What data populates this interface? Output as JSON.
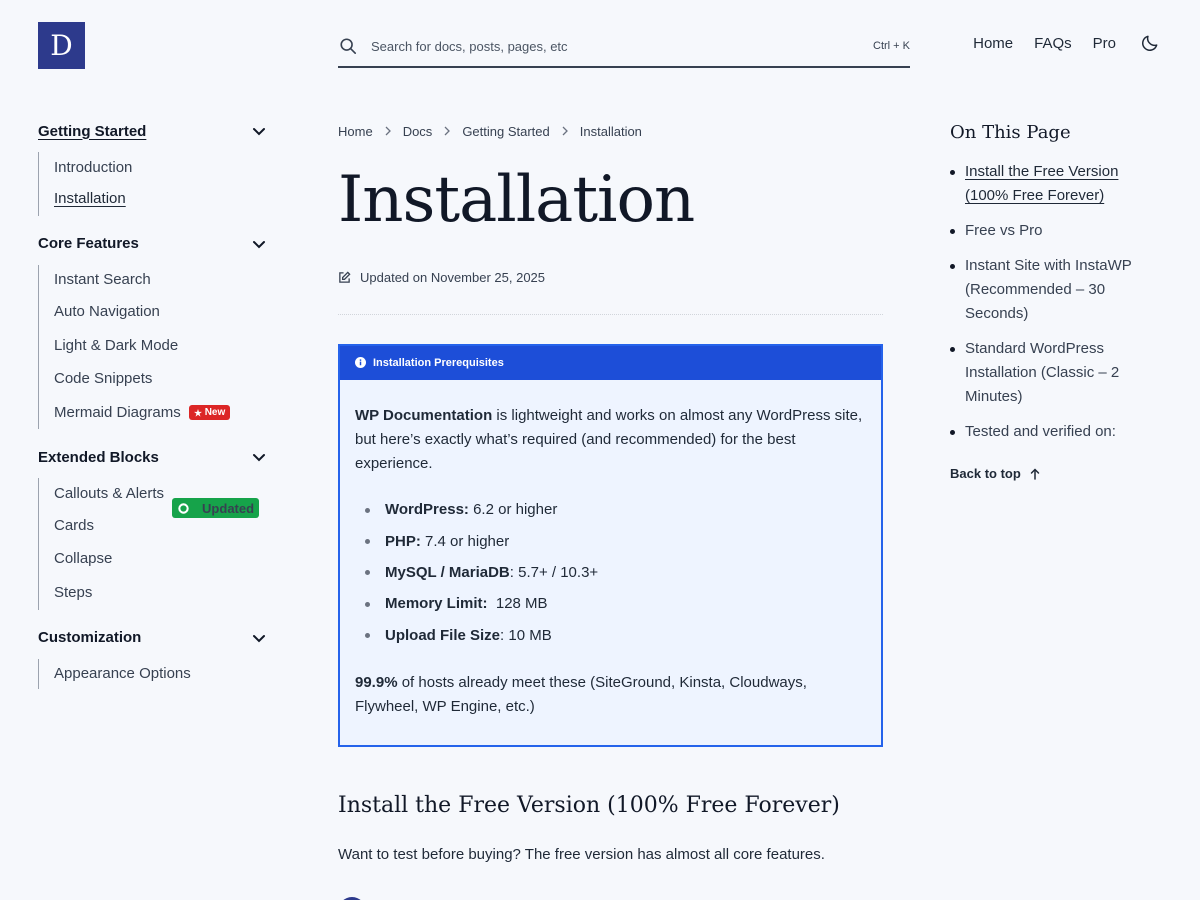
{
  "header": {
    "logo_letter": "D",
    "search_placeholder": "Search for docs, posts, pages, etc",
    "search_shortcut": "Ctrl + K",
    "nav": [
      {
        "label": "Home"
      },
      {
        "label": "FAQs"
      },
      {
        "label": "Pro"
      }
    ]
  },
  "sidebar": {
    "sections": [
      {
        "title": "Getting Started",
        "items": [
          {
            "label": "Introduction"
          },
          {
            "label": "Installation"
          }
        ]
      },
      {
        "title": "Core Features",
        "items": [
          {
            "label": "Instant Search"
          },
          {
            "label": "Auto Navigation"
          },
          {
            "label": "Light & Dark Mode"
          },
          {
            "label": "Code Snippets"
          },
          {
            "label": "Mermaid Diagrams",
            "badge": "New"
          }
        ]
      },
      {
        "title": "Extended Blocks",
        "items": [
          {
            "label": "Callouts & Alerts",
            "badge": "Updated"
          },
          {
            "label": "Cards"
          },
          {
            "label": "Collapse"
          },
          {
            "label": "Steps"
          }
        ]
      },
      {
        "title": "Customization",
        "items": [
          {
            "label": "Appearance Options"
          }
        ]
      }
    ]
  },
  "main": {
    "breadcrumb": [
      "Home",
      "Docs",
      "Getting Started",
      "Installation"
    ],
    "title": "Installation",
    "updated": "Updated on November 25, 2025",
    "callout": {
      "heading": "Installation Prerequisites",
      "intro_bold": "WP Documentation",
      "intro_rest": " is lightweight and works on almost any WordPress site, but here’s exactly what’s required (and recommended) for the best experience.",
      "requirements": [
        {
          "label": "WordPress:",
          "value": " 6.2 or higher"
        },
        {
          "label": "PHP:",
          "value": " 7.4 or higher"
        },
        {
          "label": "MySQL / MariaDB",
          "value": ": 5.7+ / 10.3+"
        },
        {
          "label": "Memory Limit:",
          "value": "  128 MB"
        },
        {
          "label": "Upload File Size",
          "value": ": 10 MB"
        }
      ],
      "footer_bold": "99.9%",
      "footer_rest": " of hosts already meet these (SiteGround, Kinsta, Cloudways, Flywheel, WP Engine, etc.)"
    },
    "section_heading": "Install the Free Version (100% Free Forever)",
    "section_text": "Want to test before buying? The free version has almost all core features."
  },
  "toc": {
    "heading": "On This Page",
    "items": [
      {
        "label": "Install the Free Version (100% Free Forever)"
      },
      {
        "label": "Free vs Pro"
      },
      {
        "label": "Instant Site with InstaWP (Recommended – 30 Seconds)"
      },
      {
        "label": "Standard WordPress Installation (Classic – 2 Minutes)"
      },
      {
        "label": "Tested and verified on:"
      }
    ],
    "back_to_top": "Back to top"
  },
  "colors": {
    "brand": "#2d3a8c",
    "callout_border": "#2563eb",
    "callout_header": "#1d4ed8",
    "callout_bg": "#eef4ff",
    "badge_new": "#dc2626",
    "badge_updated": "#16a34a"
  }
}
